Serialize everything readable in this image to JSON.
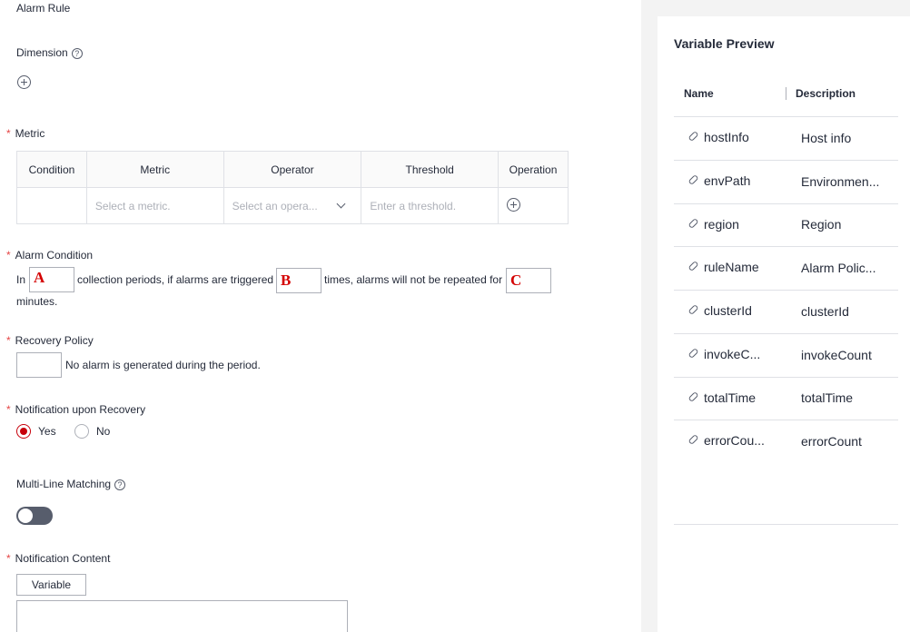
{
  "form": {
    "alarm_rule_label": "Alarm Rule",
    "dimension_label": "Dimension",
    "metric_label": "Metric",
    "metric_table": {
      "headers": [
        "Condition",
        "Metric",
        "Operator",
        "Threshold",
        "Operation"
      ],
      "metric_placeholder": "Select a metric.",
      "operator_placeholder": "Select an opera...",
      "threshold_placeholder": "Enter a threshold."
    },
    "alarm_condition": {
      "label": "Alarm Condition",
      "in_text": "In",
      "periods_text": "collection periods, if alarms are triggered",
      "times_text": "times, alarms will not be repeated for",
      "minutes_text": "minutes.",
      "marker_a": "A",
      "marker_b": "B",
      "marker_c": "C"
    },
    "recovery_policy": {
      "label": "Recovery Policy",
      "text": "No alarm is generated during the period."
    },
    "notification_recovery": {
      "label": "Notification upon Recovery",
      "yes": "Yes",
      "no": "No",
      "selected": "Yes"
    },
    "multi_line_label": "Multi-Line Matching",
    "multi_line_enabled": false,
    "notification_content_label": "Notification Content",
    "variable_button": "Variable",
    "required_mark": "*",
    "help_glyph": "?"
  },
  "variable_preview": {
    "title": "Variable Preview",
    "name_header": "Name",
    "description_header": "Description",
    "rows": [
      {
        "name": "hostInfo",
        "description": "Host info"
      },
      {
        "name": "envPath",
        "description": "Environmen..."
      },
      {
        "name": "region",
        "description": "Region"
      },
      {
        "name": "ruleName",
        "description": "Alarm Polic..."
      },
      {
        "name": "clusterId",
        "description": "clusterId"
      },
      {
        "name": "invokeC...",
        "description": "invokeCount"
      },
      {
        "name": "totalTime",
        "description": "totalTime"
      },
      {
        "name": "errorCou...",
        "description": "errorCount"
      }
    ]
  }
}
